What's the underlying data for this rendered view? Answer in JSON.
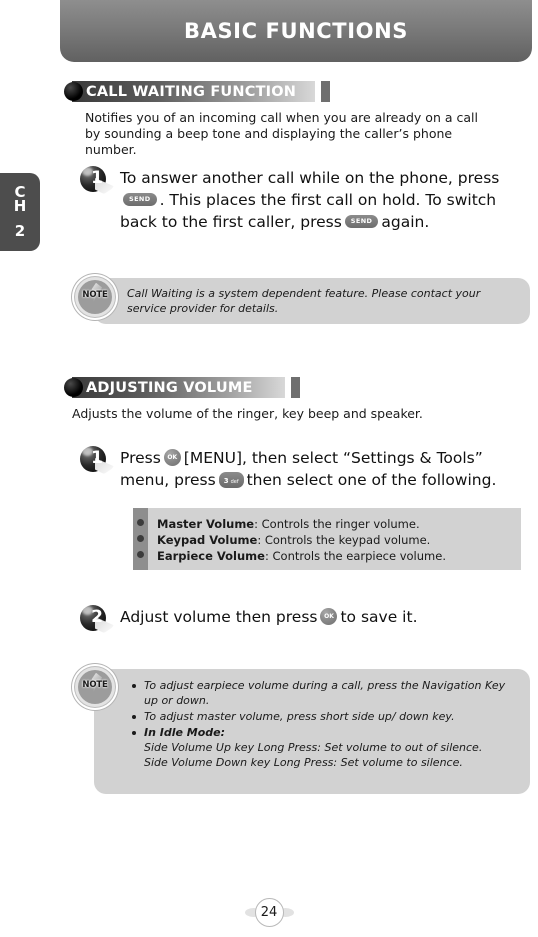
{
  "header": {
    "title": "BASIC FUNCTIONS"
  },
  "chapter_tab": {
    "line1": "C",
    "line2": "H",
    "number": "2"
  },
  "sections": [
    {
      "title": "CALL WAITING FUNCTION",
      "description": "Notifies you of an incoming call when you are already on a call by sounding a beep tone and displaying the caller’s phone number.",
      "step": {
        "number": "1",
        "part1": "To answer another call while on the phone, press",
        "part2": ". This places the first call on hold. To switch back to the first caller, press",
        "part3": "again."
      },
      "note": {
        "badge": "NOTE",
        "text": "Call Waiting is a system dependent feature. Please contact your service provider for details."
      }
    },
    {
      "title": "ADJUSTING VOLUME",
      "description": "Adjusts the volume of the ringer, key beep and speaker.",
      "step1": {
        "number": "1",
        "part1": "Press",
        "part2": "[MENU], then select “Settings & Tools” menu, press",
        "part3": "then select one of the following."
      },
      "options": [
        {
          "name": "Master Volume",
          "desc": ": Controls the ringer volume."
        },
        {
          "name": "Keypad Volume",
          "desc": ": Controls the keypad volume."
        },
        {
          "name": "Earpiece Volume",
          "desc": ": Controls the earpiece volume."
        }
      ],
      "step2": {
        "number": "2",
        "part1": "Adjust volume then press",
        "part2": "to save it."
      },
      "note": {
        "badge": "NOTE",
        "items": [
          {
            "text": "To adjust earpiece volume during a call, press the Navigation Key up or down."
          },
          {
            "text": "To adjust master volume, press short side up/ down key."
          },
          {
            "strong": "In Idle Mode:",
            "line1": "Side Volume Up key Long Press: Set volume to out of silence.",
            "line2": "Side Volume Down key Long Press: Set volume to silence."
          }
        ]
      }
    }
  ],
  "keys": {
    "send": "SEND",
    "ok": "OK",
    "three_digit": "3",
    "three_letters": "def"
  },
  "footer": {
    "page_number": "24"
  },
  "colors": {
    "header_gradient_top": "#8e8e8e",
    "header_gradient_bottom": "#616161",
    "tab_bg": "#4d4d4d",
    "note_bg": "#d2d2d2",
    "option_stripe": "#8e8e8e",
    "text": "#1a1a1a"
  }
}
